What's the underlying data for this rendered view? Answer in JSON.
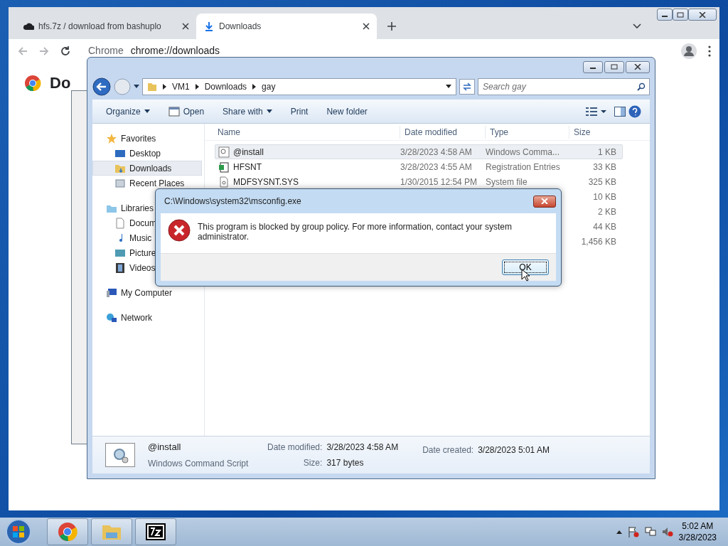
{
  "browser": {
    "tabs": [
      {
        "title": "hfs.7z / download from bashuplo",
        "selected": false
      },
      {
        "title": "Downloads",
        "selected": true
      }
    ],
    "omnibox": {
      "site": "Chrome",
      "url": "chrome://downloads"
    },
    "page_heading": "Do"
  },
  "explorer": {
    "breadcrumb": [
      "VM1",
      "Downloads",
      "gay"
    ],
    "search": {
      "placeholder": "Search gay"
    },
    "toolbar": [
      {
        "label": "Organize",
        "dropdown": true
      },
      {
        "label": "Open",
        "dropdown": false
      },
      {
        "label": "Share with",
        "dropdown": true
      },
      {
        "label": "Print",
        "dropdown": false
      },
      {
        "label": "New folder",
        "dropdown": false
      }
    ],
    "nav": [
      {
        "label": "Favorites",
        "selected": false,
        "children": [
          {
            "label": "Desktop",
            "selected": false
          },
          {
            "label": "Downloads",
            "selected": true
          },
          {
            "label": "Recent Places",
            "selected": false
          }
        ]
      },
      {
        "label": "Libraries",
        "selected": false,
        "children": [
          {
            "label": "Docum",
            "selected": false
          },
          {
            "label": "Music",
            "selected": false
          },
          {
            "label": "Picture",
            "selected": false
          },
          {
            "label": "Videos",
            "selected": false
          }
        ]
      },
      {
        "label": "My Computer",
        "selected": false
      },
      {
        "label": "Network",
        "selected": false
      }
    ],
    "columns": [
      "Name",
      "Date modified",
      "Type",
      "Size"
    ],
    "rows": [
      {
        "name": "@install",
        "date": "3/28/2023 4:58 AM",
        "type": "Windows Comma...",
        "size": "1 KB",
        "selected": true
      },
      {
        "name": "HFSNT",
        "date": "3/28/2023 4:55 AM",
        "type": "Registration Entries",
        "size": "33 KB",
        "selected": false
      },
      {
        "name": "MDFSYSNT.SYS",
        "date": "1/30/2015 12:54 PM",
        "type": "System file",
        "size": "325 KB",
        "selected": false
      },
      {
        "size": "10 KB",
        "selected": false
      },
      {
        "size": "2 KB",
        "selected": false
      },
      {
        "size": "44 KB",
        "selected": false
      },
      {
        "size": "1,456 KB",
        "selected": false
      }
    ],
    "details": {
      "name": "@install",
      "type": "Windows Command Script",
      "fields": [
        {
          "label": "Date modified:",
          "value": "3/28/2023 4:58 AM"
        },
        {
          "label": "Size:",
          "value": "317 bytes"
        },
        {
          "label": "Date created:",
          "value": "3/28/2023 5:01 AM"
        }
      ]
    }
  },
  "dialog": {
    "title": "C:\\Windows\\system32\\msconfig.exe",
    "message": "This program is blocked by group policy. For more information, contact your system administrator.",
    "button": "OK"
  },
  "taskbar": {
    "time": "5:02 AM",
    "date": "3/28/2023"
  }
}
